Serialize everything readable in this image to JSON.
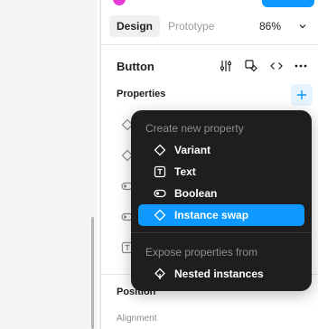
{
  "tabs": {
    "design": "Design",
    "prototype": "Prototype"
  },
  "zoom": "86%",
  "component": {
    "name": "Button"
  },
  "properties": {
    "title": "Properties"
  },
  "menu": {
    "section_create": "Create new property",
    "items": [
      {
        "label": "Variant",
        "icon": "diamond-icon"
      },
      {
        "label": "Text",
        "icon": "text-icon"
      },
      {
        "label": "Boolean",
        "icon": "toggle-icon"
      },
      {
        "label": "Instance swap",
        "icon": "instance-icon",
        "active": true
      }
    ],
    "section_expose": "Expose properties from",
    "expose_items": [
      {
        "label": "Nested instances",
        "icon": "nested-instances-icon"
      }
    ]
  },
  "position": {
    "title": "Position",
    "alignment_label": "Alignment"
  },
  "colors": {
    "accent": "#0d99ff",
    "menu_bg": "#1e1e1e",
    "menu_section": "#8f8f8f"
  }
}
